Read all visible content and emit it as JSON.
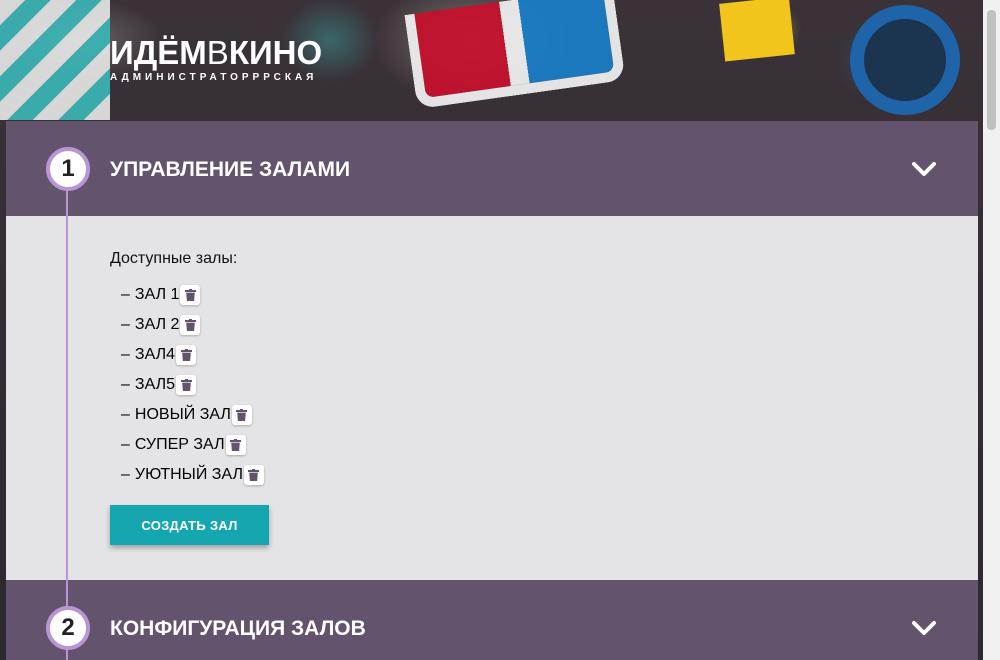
{
  "header": {
    "logo_part1": "ИДЁМ",
    "logo_part2": "В",
    "logo_part3": "КИНО",
    "logo_sub": "АДМИНИСТРАТОРРРСКАЯ"
  },
  "sections": [
    {
      "number": "1",
      "title": "УПРАВЛЕНИЕ ЗАЛАМИ",
      "expanded": true
    },
    {
      "number": "2",
      "title": "КОНФИГУРАЦИЯ ЗАЛОВ",
      "expanded": false
    }
  ],
  "halls": {
    "caption": "Доступные залы:",
    "dash": "–",
    "items": [
      "ЗАЛ 1",
      "ЗАЛ 2",
      "ЗАЛ4",
      "ЗАЛ5",
      "НОВЫЙ ЗАЛ",
      "СУПЕР ЗАЛ",
      "УЮТНЫЙ ЗАЛ"
    ],
    "delete_icon": "trash-icon",
    "create_label": "СОЗДАТЬ ЗАЛ"
  },
  "colors": {
    "section_header": "#63536c",
    "accent_line": "#b995d5",
    "button": "#16a6af",
    "icon": "#63536c"
  }
}
